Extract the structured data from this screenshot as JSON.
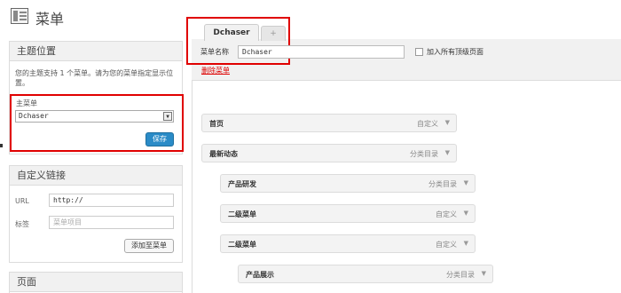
{
  "header": {
    "title": "菜单"
  },
  "theme_locations": {
    "title": "主题位置",
    "description": "您的主题支持 1 个菜单。请为您的菜单指定显示位置。",
    "select_label": "主菜单",
    "selected_menu": "Dchaser",
    "save_label": "保存"
  },
  "custom_links": {
    "title": "自定义链接",
    "url_label": "URL",
    "url_value": "http://",
    "label_label": "标签",
    "label_placeholder": "菜单项目",
    "add_button": "添加至菜单"
  },
  "pages_box": {
    "title": "页面"
  },
  "tabs": [
    {
      "label": "Dchaser"
    },
    {
      "label": "+"
    }
  ],
  "menu_editor": {
    "name_label": "菜单名称",
    "name_value": "Dchaser",
    "auto_add_label": "加入所有顶级页面",
    "auto_add_checked": false,
    "delete_label": "删除菜单"
  },
  "menu_items": [
    {
      "title": "首页",
      "type": "自定义",
      "depth": 0
    },
    {
      "title": "最新动态",
      "type": "分类目录",
      "depth": 0
    },
    {
      "title": "产品研发",
      "type": "分类目录",
      "depth": 1
    },
    {
      "title": "二级菜单",
      "type": "自定义",
      "depth": 1
    },
    {
      "title": "二级菜单",
      "type": "自定义",
      "depth": 1
    },
    {
      "title": "产品展示",
      "type": "分类目录",
      "depth": 2
    }
  ],
  "colors": {
    "accent": "#2a8bc7",
    "highlight": "#e00000",
    "delete": "#dd0000"
  }
}
